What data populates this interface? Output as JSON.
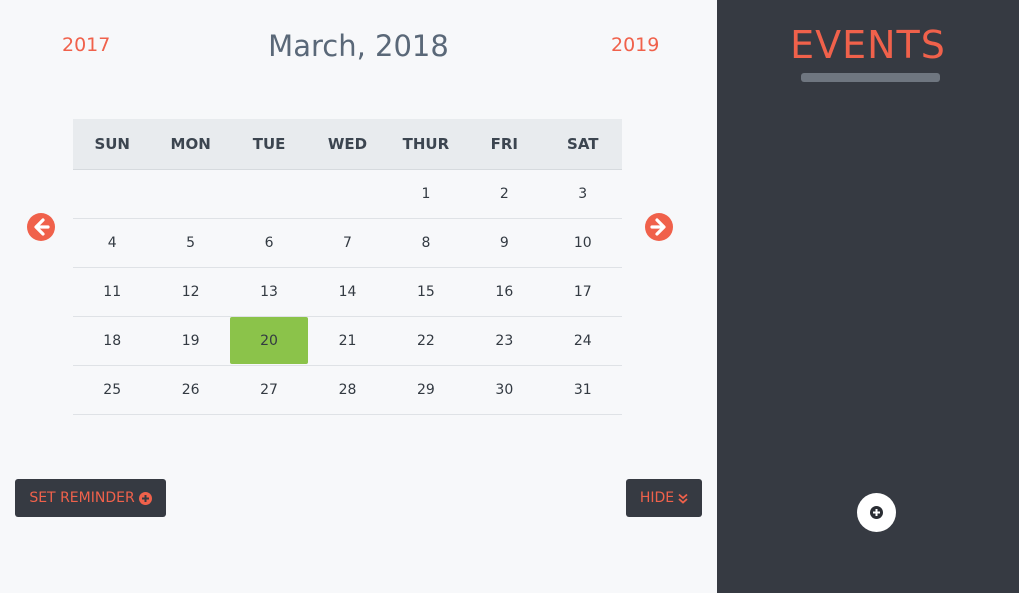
{
  "calendar": {
    "prev_year": "2017",
    "next_year": "2019",
    "title": "March, 2018",
    "weekdays": [
      "SUN",
      "MON",
      "TUE",
      "WED",
      "THUR",
      "FRI",
      "SAT"
    ],
    "weeks": [
      [
        "",
        "",
        "",
        "",
        "1",
        "2",
        "3"
      ],
      [
        "4",
        "5",
        "6",
        "7",
        "8",
        "9",
        "10"
      ],
      [
        "11",
        "12",
        "13",
        "14",
        "15",
        "16",
        "17"
      ],
      [
        "18",
        "19",
        "20",
        "21",
        "22",
        "23",
        "24"
      ],
      [
        "25",
        "26",
        "27",
        "28",
        "29",
        "30",
        "31"
      ]
    ],
    "selected_day": "20",
    "prev_month_icon": "arrow-left-circle-icon",
    "next_month_icon": "arrow-right-circle-icon"
  },
  "actions": {
    "set_reminder_label": "SET REMINDER",
    "set_reminder_icon": "plus-circle-icon",
    "hide_label": "HIDE",
    "hide_icon": "double-chevron-down-icon"
  },
  "events": {
    "title": "EVENTS",
    "add_icon": "plus-circle-icon"
  },
  "colors": {
    "accent": "#f0614b",
    "today": "#8bc34a",
    "sidebar_bg": "#363a42",
    "main_bg": "#f7f8fa",
    "header_bg": "#e8ebee"
  }
}
